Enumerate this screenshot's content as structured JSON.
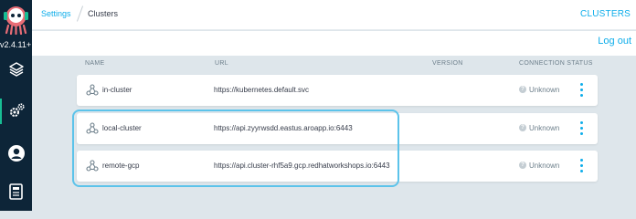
{
  "sidebar": {
    "version": "v2.4.11+",
    "items": [
      {
        "icon": "layers-icon",
        "active": false
      },
      {
        "icon": "gear-icon",
        "active": true
      },
      {
        "icon": "user-icon",
        "active": false
      },
      {
        "icon": "docs-icon",
        "active": false
      }
    ]
  },
  "header": {
    "breadcrumb_root": "Settings",
    "breadcrumb_current": "Clusters",
    "title": "CLUSTERS"
  },
  "toolbar": {
    "logout_label": "Log out"
  },
  "table": {
    "columns": [
      "NAME",
      "URL",
      "VERSION",
      "CONNECTION STATUS"
    ],
    "rows": [
      {
        "name": "in-cluster",
        "url": "https://kubernetes.default.svc",
        "version": "",
        "status": "Unknown"
      },
      {
        "name": "local-cluster",
        "url": "https://api.zyyrwsdd.eastus.aroapp.io:6443",
        "version": "",
        "status": "Unknown"
      },
      {
        "name": "remote-gcp",
        "url": "https://api.cluster-rhf5a9.gcp.redhatworkshops.io:6443",
        "version": "",
        "status": "Unknown"
      }
    ]
  },
  "colors": {
    "accent": "#0dadea",
    "sidebar_bg": "#0d2538",
    "page_bg": "#dee6eb",
    "active_indicator": "#18be94",
    "highlight": "#5cc3ea"
  }
}
